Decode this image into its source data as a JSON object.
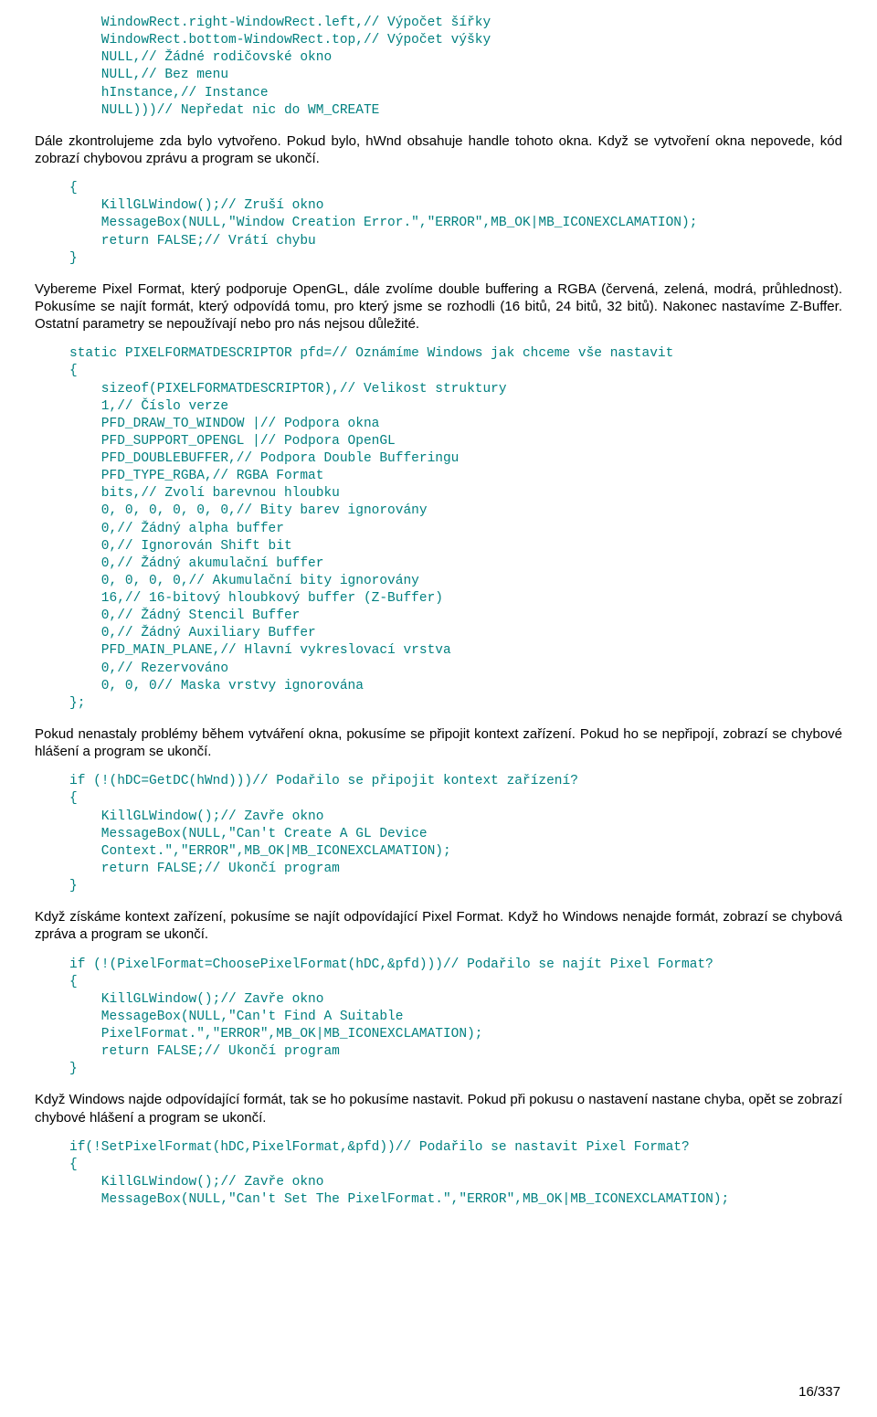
{
  "code1": "    WindowRect.right-WindowRect.left,// Výpočet šířky\n    WindowRect.bottom-WindowRect.top,// Výpočet výšky\n    NULL,// Žádné rodičovské okno\n    NULL,// Bez menu\n    hInstance,// Instance\n    NULL)))// Nepředat nic do WM_CREATE",
  "para1": "Dále zkontrolujeme zda bylo vytvořeno. Pokud bylo, hWnd obsahuje handle tohoto okna. Když se vytvoření okna nepovede, kód zobrazí chybovou zprávu a program se ukončí.",
  "code2": "{\n    KillGLWindow();// Zruší okno\n    MessageBox(NULL,\"Window Creation Error.\",\"ERROR\",MB_OK|MB_ICONEXCLAMATION);\n    return FALSE;// Vrátí chybu\n}",
  "para2": "Vybereme Pixel Format, který podporuje OpenGL, dále zvolíme double buffering a RGBA (červená, zelená, modrá, průhlednost). Pokusíme se najít formát, který odpovídá tomu, pro který jsme se rozhodli (16 bitů, 24 bitů, 32 bitů). Nakonec nastavíme Z-Buffer. Ostatní parametry se nepoužívají nebo pro nás nejsou důležité.",
  "code3": "static PIXELFORMATDESCRIPTOR pfd=// Oznámíme Windows jak chceme vše nastavit\n{\n    sizeof(PIXELFORMATDESCRIPTOR),// Velikost struktury\n    1,// Číslo verze\n    PFD_DRAW_TO_WINDOW |// Podpora okna\n    PFD_SUPPORT_OPENGL |// Podpora OpenGL\n    PFD_DOUBLEBUFFER,// Podpora Double Bufferingu\n    PFD_TYPE_RGBA,// RGBA Format\n    bits,// Zvolí barevnou hloubku\n    0, 0, 0, 0, 0, 0,// Bity barev ignorovány\n    0,// Žádný alpha buffer\n    0,// Ignorován Shift bit\n    0,// Žádný akumulační buffer\n    0, 0, 0, 0,// Akumulační bity ignorovány\n    16,// 16-bitový hloubkový buffer (Z-Buffer)\n    0,// Žádný Stencil Buffer\n    0,// Žádný Auxiliary Buffer\n    PFD_MAIN_PLANE,// Hlavní vykreslovací vrstva\n    0,// Rezervováno\n    0, 0, 0// Maska vrstvy ignorována\n};",
  "para3": "Pokud nenastaly problémy během vytváření okna, pokusíme se připojit kontext zařízení. Pokud ho se nepřipojí, zobrazí se chybové hlášení a program se ukončí.",
  "code4": "if (!(hDC=GetDC(hWnd)))// Podařilo se připojit kontext zařízení?\n{\n    KillGLWindow();// Zavře okno\n    MessageBox(NULL,\"Can't Create A GL Device\n    Context.\",\"ERROR\",MB_OK|MB_ICONEXCLAMATION);\n    return FALSE;// Ukončí program\n}",
  "para4": "Když získáme kontext zařízení, pokusíme se najít odpovídající Pixel Format. Když ho Windows nenajde formát, zobrazí se chybová zpráva a program se ukončí.",
  "code5": "if (!(PixelFormat=ChoosePixelFormat(hDC,&pfd)))// Podařilo se najít Pixel Format?\n{\n    KillGLWindow();// Zavře okno\n    MessageBox(NULL,\"Can't Find A Suitable\n    PixelFormat.\",\"ERROR\",MB_OK|MB_ICONEXCLAMATION);\n    return FALSE;// Ukončí program\n}",
  "para5": "Když Windows najde odpovídající formát, tak se ho pokusíme nastavit. Pokud při pokusu o nastavení nastane chyba, opět se zobrazí chybové hlášení a program se ukončí.",
  "code6": "if(!SetPixelFormat(hDC,PixelFormat,&pfd))// Podařilo se nastavit Pixel Format?\n{\n    KillGLWindow();// Zavře okno\n    MessageBox(NULL,\"Can't Set The PixelFormat.\",\"ERROR\",MB_OK|MB_ICONEXCLAMATION);",
  "pagenum": "16/337"
}
